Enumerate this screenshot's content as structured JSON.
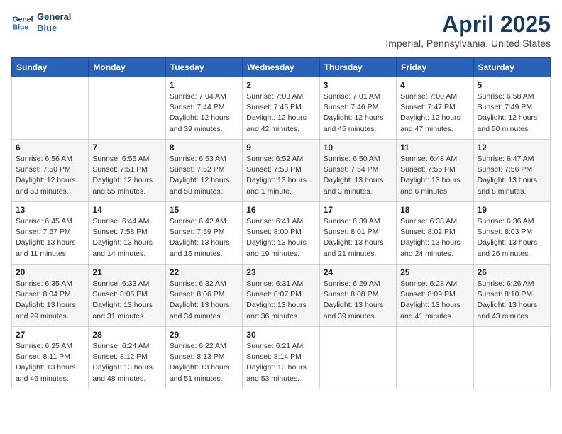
{
  "header": {
    "logo_line1": "General",
    "logo_line2": "Blue",
    "month_year": "April 2025",
    "location": "Imperial, Pennsylvania, United States"
  },
  "days_of_week": [
    "Sunday",
    "Monday",
    "Tuesday",
    "Wednesday",
    "Thursday",
    "Friday",
    "Saturday"
  ],
  "weeks": [
    [
      {
        "day": "",
        "info": ""
      },
      {
        "day": "",
        "info": ""
      },
      {
        "day": "1",
        "info": "Sunrise: 7:04 AM\nSunset: 7:44 PM\nDaylight: 12 hours and 39 minutes."
      },
      {
        "day": "2",
        "info": "Sunrise: 7:03 AM\nSunset: 7:45 PM\nDaylight: 12 hours and 42 minutes."
      },
      {
        "day": "3",
        "info": "Sunrise: 7:01 AM\nSunset: 7:46 PM\nDaylight: 12 hours and 45 minutes."
      },
      {
        "day": "4",
        "info": "Sunrise: 7:00 AM\nSunset: 7:47 PM\nDaylight: 12 hours and 47 minutes."
      },
      {
        "day": "5",
        "info": "Sunrise: 6:58 AM\nSunset: 7:49 PM\nDaylight: 12 hours and 50 minutes."
      }
    ],
    [
      {
        "day": "6",
        "info": "Sunrise: 6:56 AM\nSunset: 7:50 PM\nDaylight: 12 hours and 53 minutes."
      },
      {
        "day": "7",
        "info": "Sunrise: 6:55 AM\nSunset: 7:51 PM\nDaylight: 12 hours and 55 minutes."
      },
      {
        "day": "8",
        "info": "Sunrise: 6:53 AM\nSunset: 7:52 PM\nDaylight: 12 hours and 58 minutes."
      },
      {
        "day": "9",
        "info": "Sunrise: 6:52 AM\nSunset: 7:53 PM\nDaylight: 13 hours and 1 minute."
      },
      {
        "day": "10",
        "info": "Sunrise: 6:50 AM\nSunset: 7:54 PM\nDaylight: 13 hours and 3 minutes."
      },
      {
        "day": "11",
        "info": "Sunrise: 6:48 AM\nSunset: 7:55 PM\nDaylight: 13 hours and 6 minutes."
      },
      {
        "day": "12",
        "info": "Sunrise: 6:47 AM\nSunset: 7:56 PM\nDaylight: 13 hours and 8 minutes."
      }
    ],
    [
      {
        "day": "13",
        "info": "Sunrise: 6:45 AM\nSunset: 7:57 PM\nDaylight: 13 hours and 11 minutes."
      },
      {
        "day": "14",
        "info": "Sunrise: 6:44 AM\nSunset: 7:58 PM\nDaylight: 13 hours and 14 minutes."
      },
      {
        "day": "15",
        "info": "Sunrise: 6:42 AM\nSunset: 7:59 PM\nDaylight: 13 hours and 16 minutes."
      },
      {
        "day": "16",
        "info": "Sunrise: 6:41 AM\nSunset: 8:00 PM\nDaylight: 13 hours and 19 minutes."
      },
      {
        "day": "17",
        "info": "Sunrise: 6:39 AM\nSunset: 8:01 PM\nDaylight: 13 hours and 21 minutes."
      },
      {
        "day": "18",
        "info": "Sunrise: 6:38 AM\nSunset: 8:02 PM\nDaylight: 13 hours and 24 minutes."
      },
      {
        "day": "19",
        "info": "Sunrise: 6:36 AM\nSunset: 8:03 PM\nDaylight: 13 hours and 26 minutes."
      }
    ],
    [
      {
        "day": "20",
        "info": "Sunrise: 6:35 AM\nSunset: 8:04 PM\nDaylight: 13 hours and 29 minutes."
      },
      {
        "day": "21",
        "info": "Sunrise: 6:33 AM\nSunset: 8:05 PM\nDaylight: 13 hours and 31 minutes."
      },
      {
        "day": "22",
        "info": "Sunrise: 6:32 AM\nSunset: 8:06 PM\nDaylight: 13 hours and 34 minutes."
      },
      {
        "day": "23",
        "info": "Sunrise: 6:31 AM\nSunset: 8:07 PM\nDaylight: 13 hours and 36 minutes."
      },
      {
        "day": "24",
        "info": "Sunrise: 6:29 AM\nSunset: 8:08 PM\nDaylight: 13 hours and 39 minutes."
      },
      {
        "day": "25",
        "info": "Sunrise: 6:28 AM\nSunset: 8:09 PM\nDaylight: 13 hours and 41 minutes."
      },
      {
        "day": "26",
        "info": "Sunrise: 6:26 AM\nSunset: 8:10 PM\nDaylight: 13 hours and 43 minutes."
      }
    ],
    [
      {
        "day": "27",
        "info": "Sunrise: 6:25 AM\nSunset: 8:11 PM\nDaylight: 13 hours and 46 minutes."
      },
      {
        "day": "28",
        "info": "Sunrise: 6:24 AM\nSunset: 8:12 PM\nDaylight: 13 hours and 48 minutes."
      },
      {
        "day": "29",
        "info": "Sunrise: 6:22 AM\nSunset: 8:13 PM\nDaylight: 13 hours and 51 minutes."
      },
      {
        "day": "30",
        "info": "Sunrise: 6:21 AM\nSunset: 8:14 PM\nDaylight: 13 hours and 53 minutes."
      },
      {
        "day": "",
        "info": ""
      },
      {
        "day": "",
        "info": ""
      },
      {
        "day": "",
        "info": ""
      }
    ]
  ]
}
